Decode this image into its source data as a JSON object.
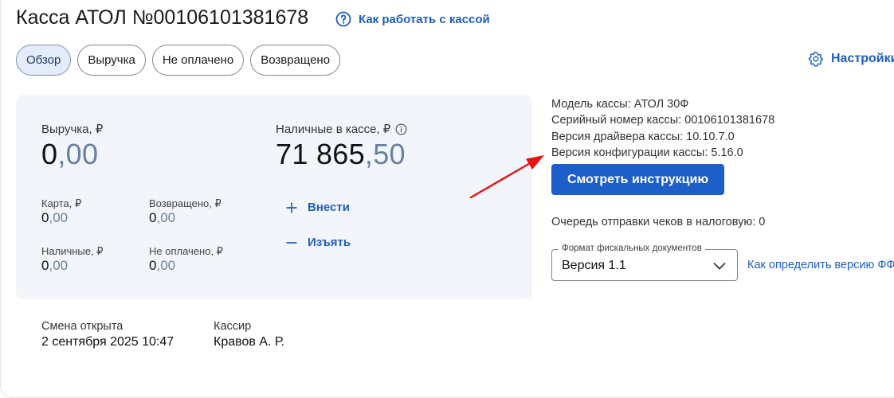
{
  "title": "Касса АТОЛ №00106101381678",
  "help_link": "Как работать с кассой",
  "settings_label": "Настройки",
  "tabs": [
    "Обзор",
    "Выручка",
    "Не оплачено",
    "Возвращено"
  ],
  "revenue": {
    "label": "Выручка, ₽",
    "int": "0",
    "frac": ",00",
    "card": {
      "label": "Карта, ₽",
      "int": "0",
      "frac": ",00"
    },
    "returned": {
      "label": "Возвращено, ₽",
      "int": "0",
      "frac": ",00"
    },
    "cash": {
      "label": "Наличные, ₽",
      "int": "0",
      "frac": ",00"
    },
    "unpaid": {
      "label": "Не оплачено, ₽",
      "int": "0",
      "frac": ",00"
    }
  },
  "cash_in_register": {
    "label": "Наличные в кассе, ₽",
    "int": "71 865",
    "frac": ",50"
  },
  "actions": {
    "deposit": "Внести",
    "withdraw": "Изъять"
  },
  "info": {
    "model": "Модель кассы: АТОЛ 30Ф",
    "serial": "Серийный номер кассы: 00106101381678",
    "driver": "Версия драйвера кассы: 10.10.7.0",
    "config": "Версия конфигурации кассы: 5.16.0"
  },
  "instruction_button": "Смотреть инструкцию",
  "queue": "Очередь отправки чеков в налоговую: 0",
  "format_select": {
    "legend": "Формат фискальных документов",
    "value": "Версия 1.1"
  },
  "how_to_link": "Как определить версию ФФД",
  "shift": {
    "opened_label": "Смена открыта",
    "opened_value": "2 сентября 2025 10:47",
    "cashier_label": "Кассир",
    "cashier_value": "Кравов А. Р."
  },
  "colors": {
    "accent": "#1f5fbf",
    "button": "#1e5ec8",
    "panel": "#f2f5f9",
    "annotation_arrow": "#e81414"
  }
}
